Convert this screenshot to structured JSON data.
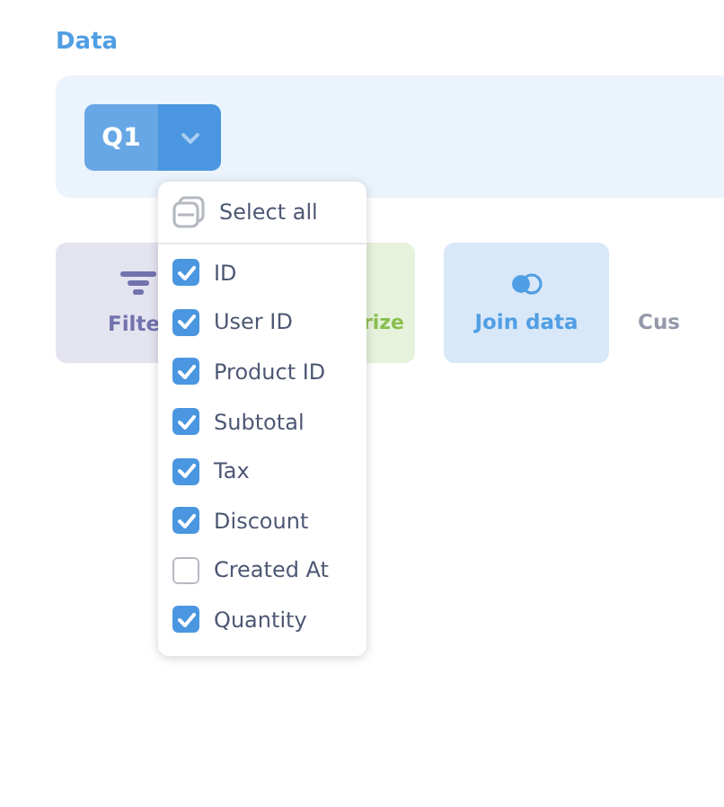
{
  "section_label": "Data",
  "query": {
    "label": "Q1"
  },
  "actions": [
    {
      "kind": "filter",
      "label": "Filte"
    },
    {
      "kind": "summarize",
      "label": "rize"
    },
    {
      "kind": "join",
      "label": "Join data"
    },
    {
      "kind": "plain",
      "label": "Cus"
    }
  ],
  "column_menu": {
    "select_all": "Select all",
    "columns": [
      {
        "label": "ID",
        "checked": true
      },
      {
        "label": "User ID",
        "checked": true
      },
      {
        "label": "Product ID",
        "checked": true
      },
      {
        "label": "Subtotal",
        "checked": true
      },
      {
        "label": "Tax",
        "checked": true
      },
      {
        "label": "Discount",
        "checked": true
      },
      {
        "label": "Created At",
        "checked": false
      },
      {
        "label": "Quantity",
        "checked": true
      }
    ]
  }
}
